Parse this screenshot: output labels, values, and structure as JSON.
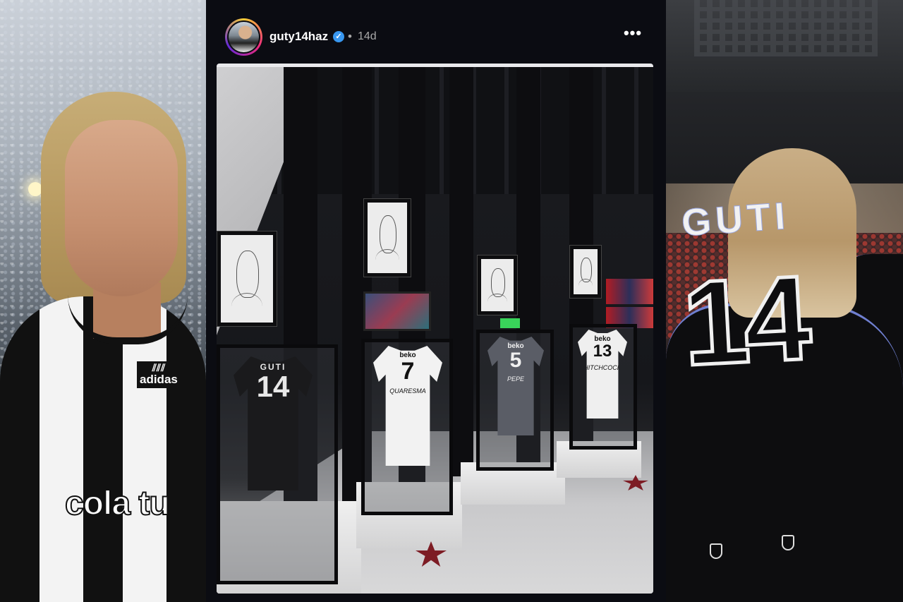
{
  "left_panel": {
    "shirt_brand": "adidas",
    "sponsor": "cola tu"
  },
  "post": {
    "username": "guty14haz",
    "verified_icon": "verified-check-icon",
    "separator": "•",
    "time_ago": "14d",
    "more_icon": "•••",
    "photo": {
      "jerseys": [
        {
          "name": "GUTI",
          "number": "14",
          "sponsor": "",
          "signature": "",
          "color": "#1a1a1c",
          "text_color": "#e8e8e8"
        },
        {
          "name": "",
          "number": "7",
          "sponsor": "beko",
          "signature": "QUARESMA",
          "color": "#f2f2f2",
          "text_color": "#111111"
        },
        {
          "name": "",
          "number": "5",
          "sponsor": "beko",
          "signature": "PEPE",
          "color": "#5a5d66",
          "text_color": "#f0f0f0"
        },
        {
          "name": "",
          "number": "13",
          "sponsor": "beko",
          "signature": "HITCHCOCK",
          "color": "#efefef",
          "text_color": "#111111"
        }
      ]
    }
  },
  "right_panel": {
    "jersey_name": "GUTI",
    "jersey_number": "14"
  }
}
